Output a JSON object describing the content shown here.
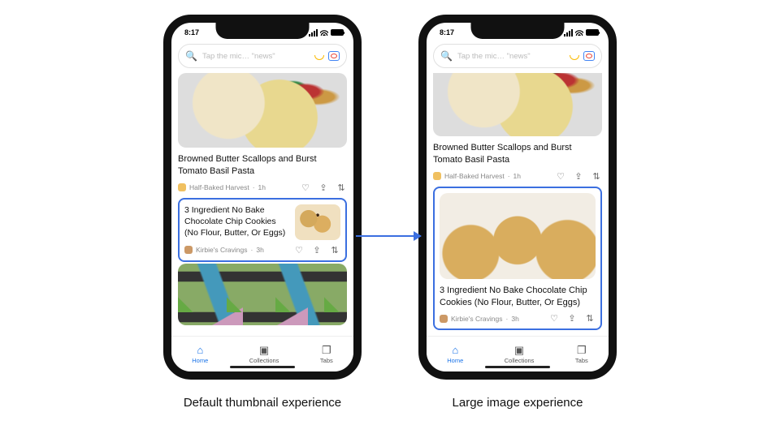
{
  "captions": {
    "left": "Default thumbnail experience",
    "right": "Large image experience"
  },
  "status": {
    "time": "8:17"
  },
  "search": {
    "placeholder": "Tap the mic… \"news\""
  },
  "cards": {
    "pasta": {
      "title": "Browned Butter Scallops and Burst Tomato Basil Pasta",
      "source": "Half-Baked Harvest",
      "age": "1h"
    },
    "cookies": {
      "title": "3 Ingredient No Bake Chocolate Chip Cookies (No Flour, Butter, Or Eggs)",
      "source": "Kirbie's Cravings",
      "age": "3h"
    }
  },
  "nav": {
    "home": "Home",
    "collections": "Collections",
    "tabs": "Tabs"
  }
}
